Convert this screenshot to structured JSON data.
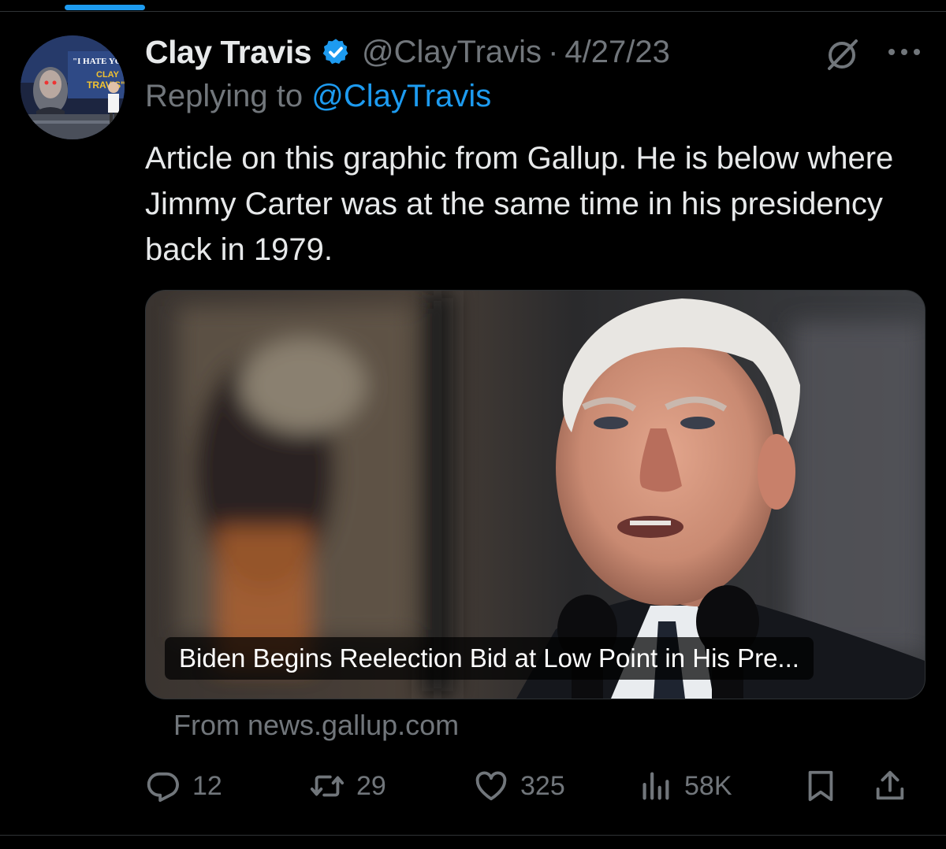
{
  "tweet": {
    "author": {
      "display_name": "Clay Travis",
      "handle": "@ClayTravis",
      "verified": true,
      "avatar_sign_text": "\"I HATE YOU CLAY TRAVIS\""
    },
    "separator": "·",
    "date": "4/27/23",
    "replying_to_prefix": "Replying to ",
    "replying_to_handle": "@ClayTravis",
    "text": "Article on this graphic from Gallup. He is below where Jimmy Carter was at the same time in his presidency back in 1979.",
    "card": {
      "title": "Biden Begins Reelection Bid at Low Point in His Pre...",
      "source": "From news.gallup.com"
    },
    "stats": {
      "replies": "12",
      "retweets": "29",
      "likes": "325",
      "views": "58K"
    }
  },
  "icons": {
    "verified": "verified-badge-icon",
    "grok": "grok-icon",
    "more": "more-icon",
    "reply": "reply-icon",
    "retweet": "retweet-icon",
    "like": "heart-icon",
    "views": "views-icon",
    "bookmark": "bookmark-icon",
    "share": "share-icon"
  },
  "colors": {
    "background": "#000000",
    "text": "#e7e9ea",
    "muted": "#71767b",
    "accent": "#1d9bf0",
    "divider": "#2f3336"
  }
}
